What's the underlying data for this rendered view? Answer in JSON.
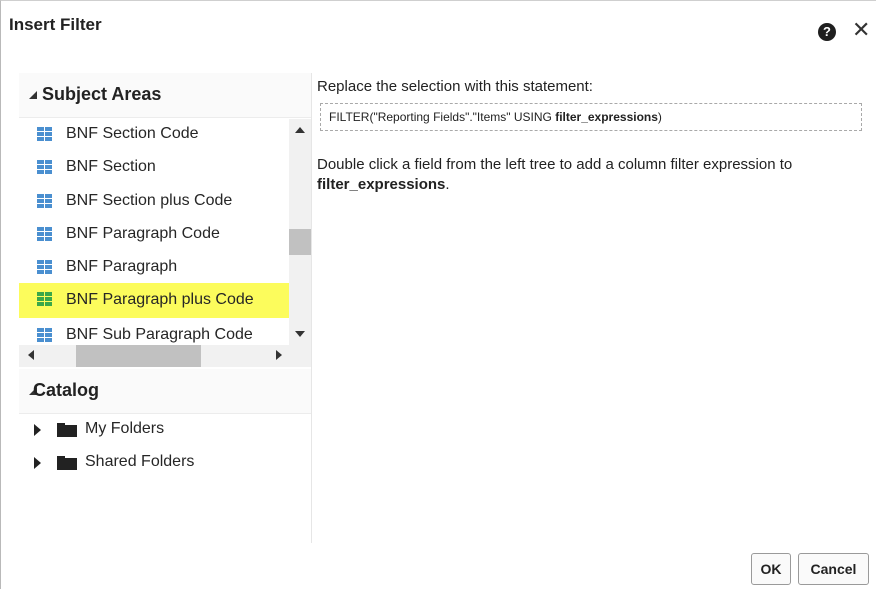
{
  "dialog": {
    "title": "Insert Filter",
    "help_icon": "question-circle-icon",
    "close_glyph": "✕"
  },
  "subject_areas": {
    "header": "Subject Areas",
    "items": [
      {
        "label": "BNF Section Code",
        "selected": false
      },
      {
        "label": "BNF Section",
        "selected": false
      },
      {
        "label": "BNF Section plus Code",
        "selected": false
      },
      {
        "label": "BNF Paragraph Code",
        "selected": false
      },
      {
        "label": "BNF Paragraph",
        "selected": false
      },
      {
        "label": "BNF Paragraph plus Code",
        "selected": true
      },
      {
        "label": "BNF Sub Paragraph Code",
        "selected": false
      }
    ]
  },
  "catalog": {
    "header": "Catalog",
    "items": [
      {
        "label": "My Folders"
      },
      {
        "label": "Shared Folders"
      }
    ]
  },
  "editor": {
    "instruction": "Replace the selection with this statement:",
    "statement_prefix": "FILTER(\"Reporting Fields\".\"Items\" USING ",
    "statement_bold": "filter_expressions",
    "statement_suffix": ")",
    "help_prefix": "Double click a field from the left tree to add a column filter expression to ",
    "help_bold": "filter_expressions",
    "help_suffix": "."
  },
  "buttons": {
    "ok": "OK",
    "cancel": "Cancel"
  },
  "colors": {
    "selection_highlight": "#fcfc5c",
    "column_icon_blue": "#4a8fd0",
    "column_icon_green": "#3aa849"
  }
}
